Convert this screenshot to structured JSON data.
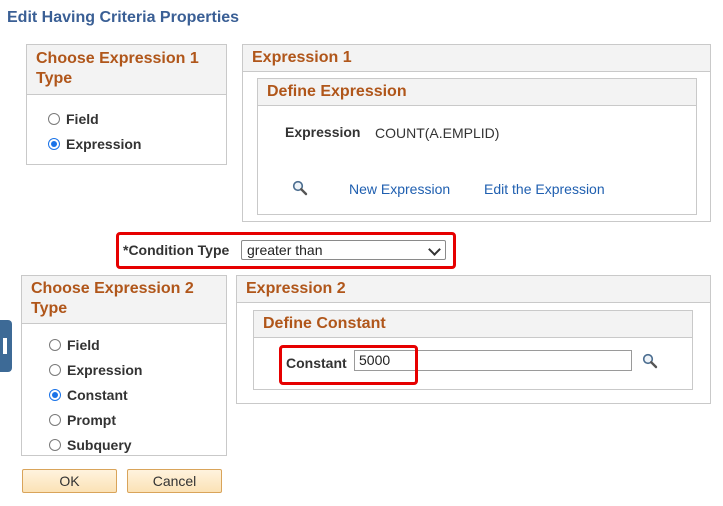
{
  "page": {
    "title": "Edit Having Criteria Properties"
  },
  "expr1_type": {
    "heading": "Choose Expression 1 Type",
    "options": [
      "Field",
      "Expression"
    ],
    "selected": "Expression"
  },
  "expr1": {
    "heading": "Expression 1",
    "define_heading": "Define Expression",
    "expression_label": "Expression",
    "expression_value": "COUNT(A.EMPLID)",
    "new_link": "New Expression",
    "edit_link": "Edit the Expression",
    "lookup_icon": "magnifier-icon"
  },
  "condition": {
    "label": "*Condition Type",
    "value": "greater than"
  },
  "expr2_type": {
    "heading": "Choose Expression 2 Type",
    "options": [
      "Field",
      "Expression",
      "Constant",
      "Prompt",
      "Subquery"
    ],
    "selected": "Constant"
  },
  "expr2": {
    "heading": "Expression 2",
    "define_heading": "Define Constant",
    "constant_label": "Constant",
    "constant_value": "5000",
    "lookup_icon": "magnifier-icon"
  },
  "buttons": {
    "ok": "OK",
    "cancel": "Cancel"
  },
  "colors": {
    "heading": "#b0561a",
    "title": "#3a5f95",
    "link": "#1f5fb0",
    "highlight": "#e60000"
  }
}
